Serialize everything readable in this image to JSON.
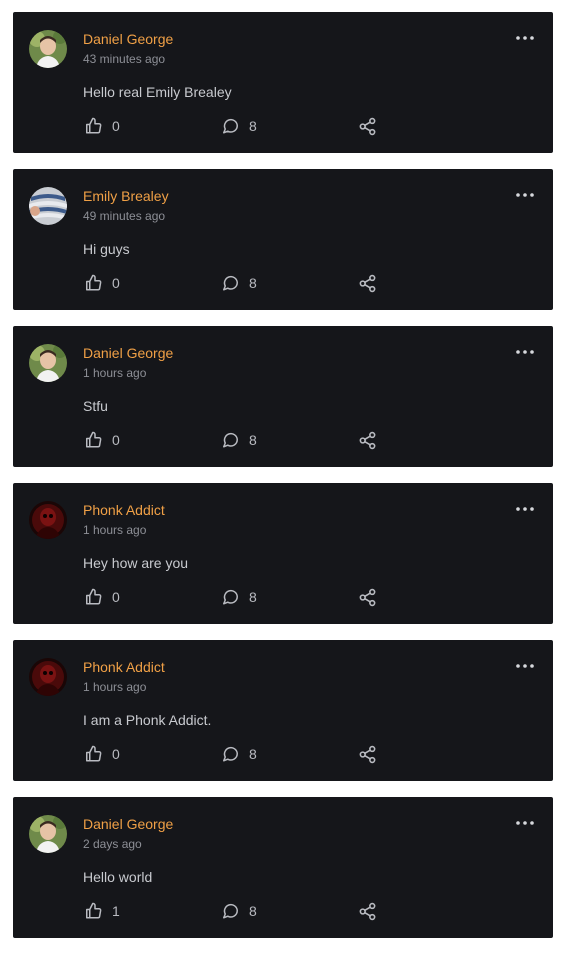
{
  "colors": {
    "card_background": "#15161a",
    "author_name": "#f0a046",
    "timestamp": "#8d8f96",
    "body_text": "#c8cacf",
    "icon": "#b9bbc1"
  },
  "icons": {
    "menu": "more-horizontal-icon",
    "like": "thumbs-up-icon",
    "comment": "comment-bubble-icon",
    "share": "share-icon"
  },
  "posts": [
    {
      "author": "Daniel George",
      "time": "43 minutes ago",
      "text": "Hello real Emily Brealey",
      "likes": "0",
      "comments": "8",
      "avatar": "daniel"
    },
    {
      "author": "Emily Brealey",
      "time": "49 minutes ago",
      "text": "Hi guys",
      "likes": "0",
      "comments": "8",
      "avatar": "emily"
    },
    {
      "author": "Daniel George",
      "time": "1 hours ago",
      "text": "Stfu",
      "likes": "0",
      "comments": "8",
      "avatar": "daniel"
    },
    {
      "author": "Phonk Addict",
      "time": "1 hours ago",
      "text": "Hey how are you",
      "likes": "0",
      "comments": "8",
      "avatar": "phonk"
    },
    {
      "author": "Phonk Addict",
      "time": "1 hours ago",
      "text": "I am a Phonk Addict.",
      "likes": "0",
      "comments": "8",
      "avatar": "phonk"
    },
    {
      "author": "Daniel George",
      "time": "2 days ago",
      "text": "Hello world",
      "likes": "1",
      "comments": "8",
      "avatar": "daniel"
    }
  ]
}
